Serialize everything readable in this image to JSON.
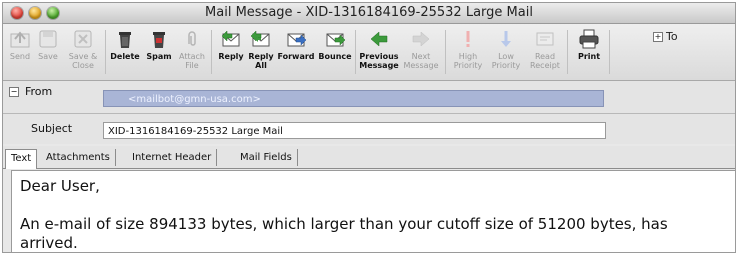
{
  "window": {
    "title": "Mail Message - XID-1316184169-25532 Large Mail"
  },
  "toolbar": {
    "buttons": [
      {
        "label": "Send",
        "icon": "send-icon",
        "enabled": false
      },
      {
        "label": "Save",
        "icon": "save-icon",
        "enabled": false
      },
      {
        "label": "Save &\nClose",
        "icon": "save-close-icon",
        "enabled": false
      },
      {
        "label": "Delete",
        "icon": "trash-icon",
        "enabled": true
      },
      {
        "label": "Spam",
        "icon": "spam-trash-icon",
        "enabled": true
      },
      {
        "label": "Attach\nFile",
        "icon": "paperclip-icon",
        "enabled": false
      },
      {
        "label": "Reply",
        "icon": "reply-envelope-icon",
        "enabled": true
      },
      {
        "label": "Reply\nAll",
        "icon": "reply-all-envelope-icon",
        "enabled": true
      },
      {
        "label": "Forward",
        "icon": "forward-envelope-icon",
        "enabled": true
      },
      {
        "label": "Bounce",
        "icon": "bounce-envelope-icon",
        "enabled": true
      },
      {
        "label": "Previous\nMessage",
        "icon": "left-arrow-icon",
        "enabled": true
      },
      {
        "label": "Next\nMessage",
        "icon": "right-arrow-icon",
        "enabled": false
      },
      {
        "label": "High\nPriority",
        "icon": "exclamation-icon",
        "enabled": false
      },
      {
        "label": "Low\nPriority",
        "icon": "down-arrow-icon",
        "enabled": false
      },
      {
        "label": "Read\nReceipt",
        "icon": "receipt-icon",
        "enabled": false
      },
      {
        "label": "Print",
        "icon": "printer-icon",
        "enabled": true
      }
    ],
    "to_label": "To"
  },
  "header": {
    "from_label": "From",
    "from_value": "<mailbot@gmn-usa.com>",
    "subject_label": "Subject",
    "subject_value": "XID-1316184169-25532 Large Mail"
  },
  "tabs": [
    "Text",
    "Attachments",
    "Internet Header",
    "Mail Fields"
  ],
  "active_tab": "Text",
  "body": {
    "greeting": "Dear User,",
    "paragraph": "An e-mail of size 894133 bytes, which larger than your cutoff size of 51200 bytes, has arrived."
  },
  "colors": {
    "from_field_bg": "#a9b5d6",
    "accent_green": "#3c9a3c",
    "accent_blue": "#3a6fc2"
  }
}
